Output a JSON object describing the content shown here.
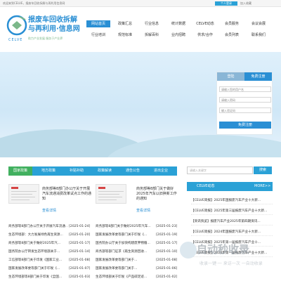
{
  "topbar": {
    "welcome": "欢迎来到CELVE，报废车回收拆解与再利用信息网",
    "login": "个人登录",
    "favorite": "加入收藏"
  },
  "logo": {
    "cn_line1": "报废车回收拆解",
    "cn_line2": "与再利用·信息网",
    "en": "CELVE",
    "slogan": "助力产业发展  服务于产业界"
  },
  "nav": {
    "row1": [
      "网站首页",
      "政策汇总",
      "行业信息",
      "统计数据",
      "CELVE动态",
      "会员服务",
      "会议会展"
    ],
    "row2": [
      "行业培训",
      "规范标准",
      "拆解百科",
      "业内招聘",
      "供求/合作",
      "会员列表",
      "联系我们"
    ]
  },
  "login": {
    "tab_login": "登陆",
    "tab_register": "免费注册",
    "username_placeholder": "请输入您的用户名",
    "password_placeholder": "请输入密码",
    "captcha_placeholder": "输入验证码",
    "submit": "免费注册"
  },
  "tabs": [
    "国家政策",
    "地方政策",
    "补贴补助",
    "政策解读",
    "通告公告",
    "进出企业"
  ],
  "search": {
    "placeholder": "请输入关键字",
    "button": "搜索"
  },
  "featured": [
    {
      "title": "商务部等8部门办公厅关于开展汽车流通消费改革试点工作的通知",
      "link": "查看详情"
    },
    {
      "title": "商务部等8部门关于做好2025年汽车以旧换新工作的通知",
      "link": "查看详情"
    }
  ],
  "news": [
    {
      "title": "商务部等8部门办公厅关于开展汽车流通...",
      "date": "[2025-01-24]"
    },
    {
      "title": "商务部等8部门关于做好2025年汽车...",
      "date": "[2025-01-23]"
    },
    {
      "title": "生态环境部：大力发展绿色再生资源...",
      "date": "[2025-01-20]"
    },
    {
      "title": "国家发展改革委等部门关于印发《...",
      "date": "[2025-01-19]"
    },
    {
      "title": "商务部等8部门关于做好2025年汽...",
      "date": "[2025-01-17]"
    },
    {
      "title": "国务院办公厅关于加快构建废弃物循...",
      "date": "[2025-01-17]"
    },
    {
      "title": "国务院办公厅转发生态环境部关于...",
      "date": "[2025-01-14]"
    },
    {
      "title": "商务部等部门征求《再生资源回收...",
      "date": "[2025-01-10]"
    },
    {
      "title": "工信部等8部门关于印发《国家工业...",
      "date": "[2025-01-08]"
    },
    {
      "title": "国家发展改革委等部门关于...",
      "date": "[2025-01-08]"
    },
    {
      "title": "国家发展改革委等部门关于印发《...",
      "date": "[2025-01-07]"
    },
    {
      "title": "国家发展改革委等部门关于...",
      "date": "[2025-01-06]"
    },
    {
      "title": "生态环境部等8部门关于印发《全国...",
      "date": "[2025-01-03]"
    },
    {
      "title": "生态环境部关于印发《产品碳足迹...",
      "date": "[2025-01-02]"
    }
  ],
  "sidebar": {
    "title": "CELVE动态",
    "more": "MORE>>",
    "items": [
      "【CELVE简报】2025年国报废汽车产业十大新...",
      "【CELVE简报】2025年第三届报废汽车产业十大新...",
      "【资讯快览】报废汽车产业2025年第四期资讯...",
      "【CELVE简报】2024年国报废汽车产业十大新...",
      "【CELVE简报】2025年第一届报废汽车产业十...",
      "【CELVE简报】2024年第一届报废汽车产业十大新..."
    ]
  },
  "watermark": {
    "text": "自动秒收录",
    "sub": "收录一键·一 来访一次 一自动收录"
  },
  "colors": {
    "primary": "#2aa1d6",
    "active_tab": "#41b05f",
    "logo": "#2a8fd4"
  }
}
